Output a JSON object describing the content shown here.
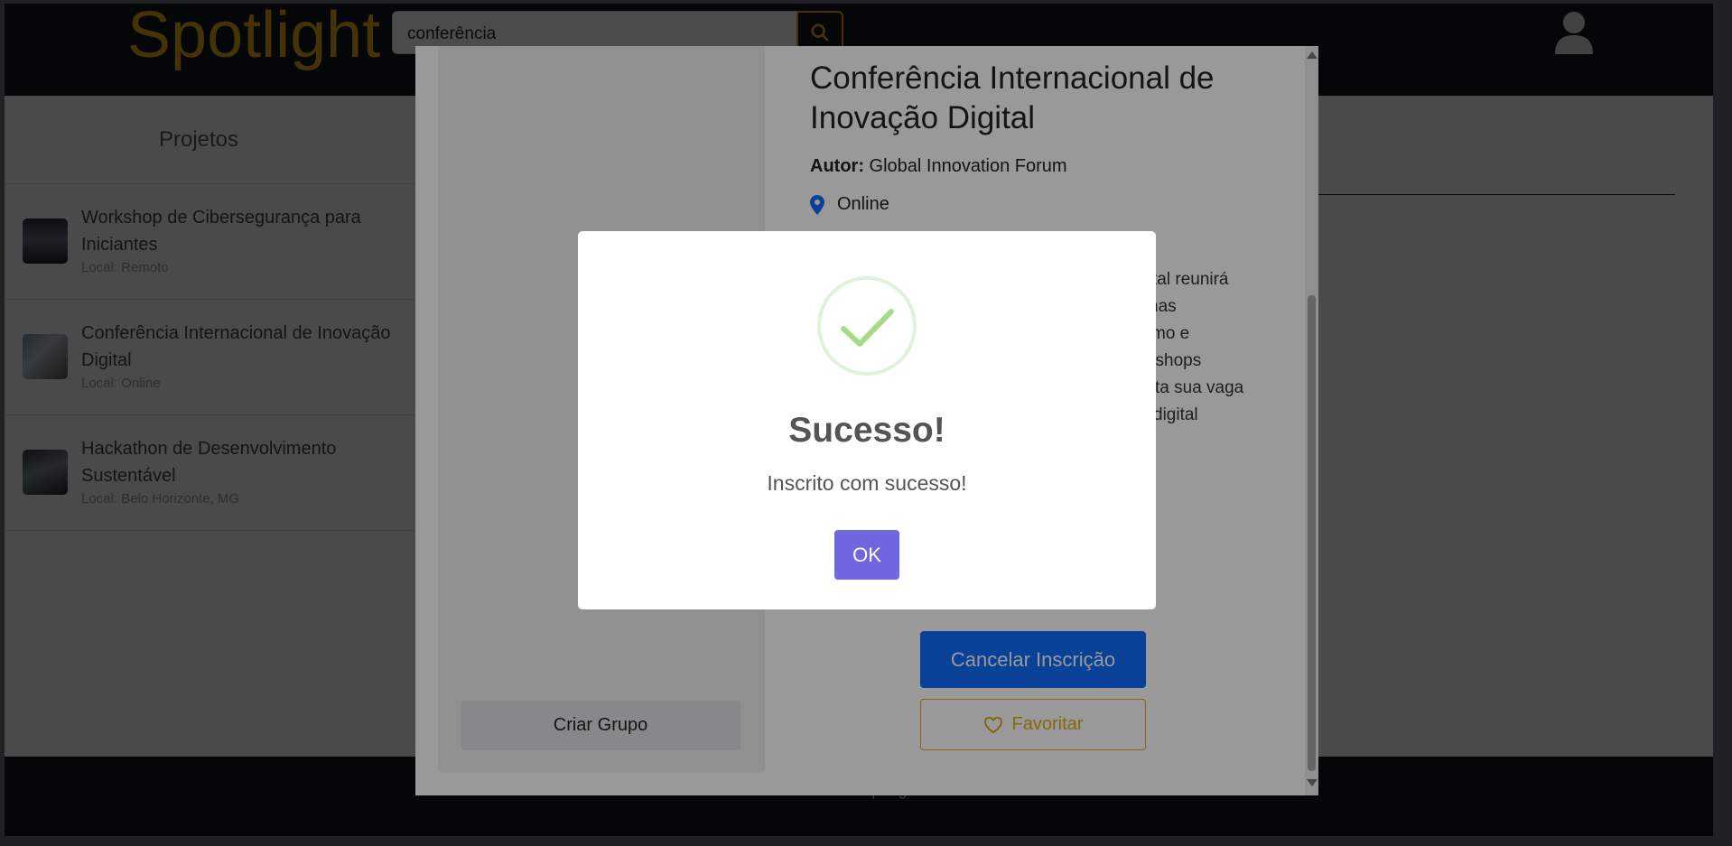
{
  "header": {
    "logo": "Spotlight",
    "search_value": "conferência"
  },
  "sidebar": {
    "title": "Projetos",
    "items": [
      {
        "title": "Workshop de Cibersegurança para Iniciantes",
        "local": "Local: Remoto"
      },
      {
        "title": "Conferência Internacional de Inovação Digital",
        "local": "Local: Online"
      },
      {
        "title": "Hackathon de Desenvolvimento Sustentável",
        "local": "Local: Belo Horizonte, MG"
      }
    ]
  },
  "footer": {
    "text": "Spotlight"
  },
  "detail": {
    "title": "Conferência Internacional de Inovação Digital",
    "autor_label": "Autor:",
    "autor": "Global Innovation Forum",
    "location": "Online",
    "description_fragments": [
      "igital reunirá",
      "nas",
      "mo e",
      "kshops",
      "ta sua vaga",
      "digital"
    ],
    "criar_grupo": "Criar Grupo",
    "cancel_button": "Cancelar Inscrição",
    "favorite_button": "Favoritar"
  },
  "alert": {
    "title": "Sucesso!",
    "text": "Inscrito com sucesso!",
    "ok": "OK"
  },
  "colors": {
    "brand": "#e6a817",
    "primary": "#0d6efd",
    "confirm": "#7066e0",
    "success": "#a5dc86"
  }
}
